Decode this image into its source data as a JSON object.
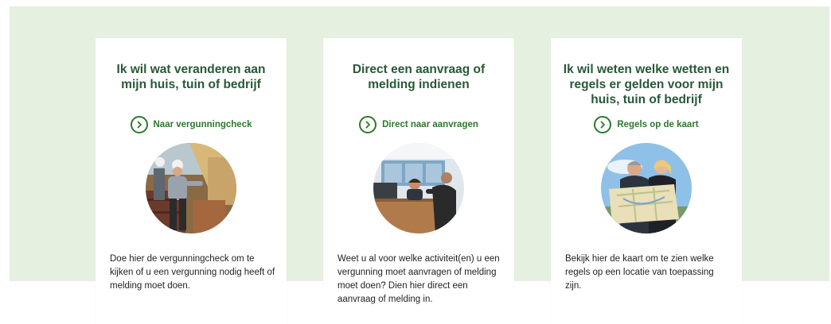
{
  "colors": {
    "band": "#e6f0e1",
    "title": "#275937",
    "link": "#2b7a2b",
    "text": "#222222"
  },
  "cards": [
    {
      "title": "Ik wil wat veranderen aan mijn huis, tuin of bedrijf",
      "cta_icon": "chevron-right-circle-icon",
      "cta_label": "Naar vergunningcheck",
      "image": "construction-workers-photo",
      "description": "Doe hier de vergunningcheck om te kijken of u een vergunning nodig heeft of melding moet doen."
    },
    {
      "title": "Direct een aanvraag of melding indienen",
      "cta_icon": "chevron-right-circle-icon",
      "cta_label": "Direct naar aanvragen",
      "image": "service-desk-photo",
      "description": "Weet u al voor welke activiteit(en) u een vergunning moet aanvragen of melding moet doen? Dien hier direct een aanvraag of melding in."
    },
    {
      "title": "Ik wil weten welke wetten en regels er gelden voor mijn huis, tuin of bedrijf",
      "cta_icon": "chevron-right-circle-icon",
      "cta_label": "Regels op de kaart",
      "image": "people-reading-map-photo",
      "description": "Bekijk hier de kaart om te zien welke regels op een locatie van toepassing zijn."
    }
  ]
}
